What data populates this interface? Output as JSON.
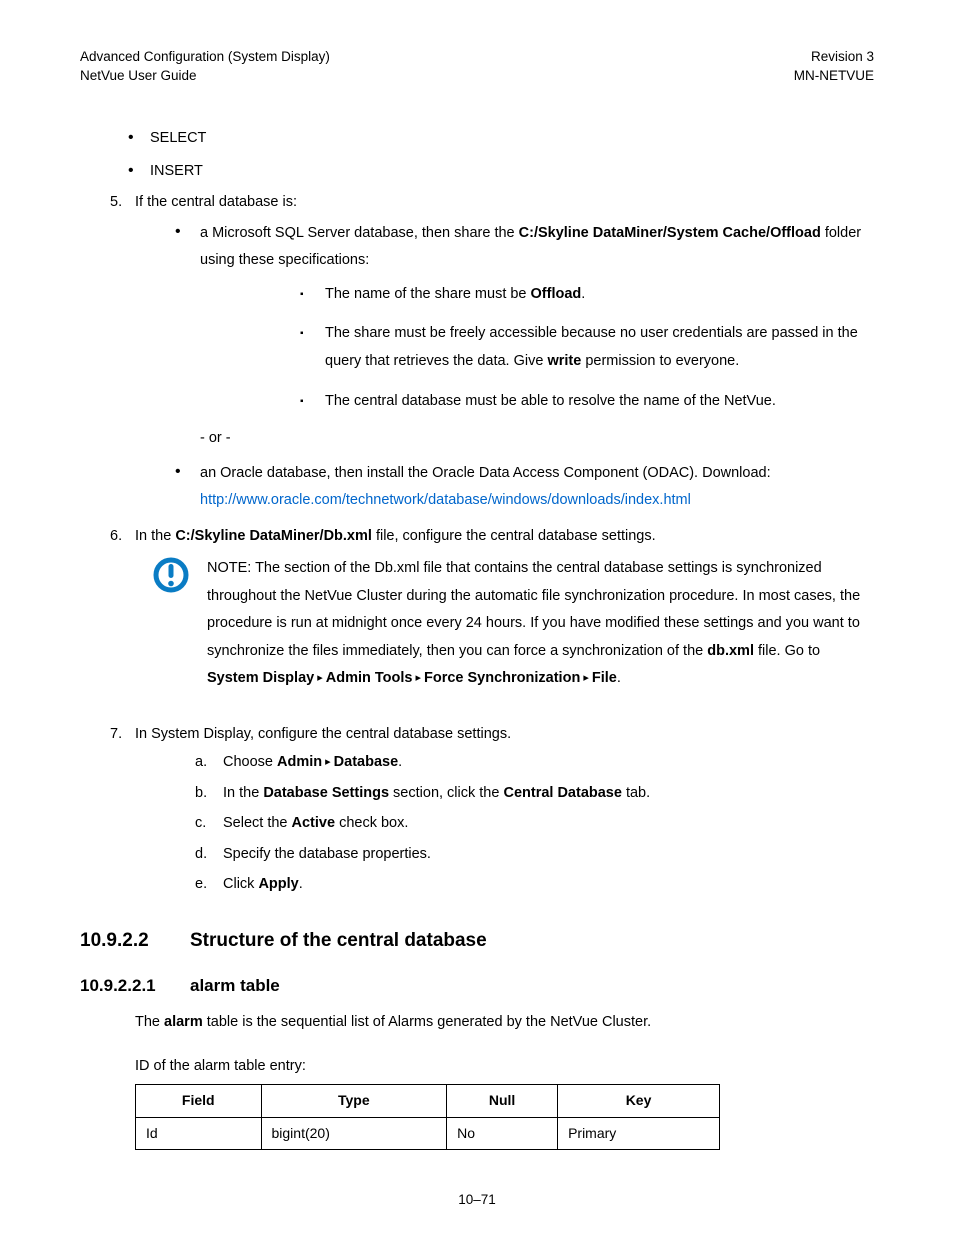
{
  "header": {
    "left_line1": "Advanced Configuration (System Display)",
    "left_line2": "NetVue User Guide",
    "right_line1": "Revision 3",
    "right_line2": "MN-NETVUE"
  },
  "top_bullets": [
    "SELECT",
    "INSERT"
  ],
  "step5": {
    "num": "5.",
    "intro": "If the central database is:",
    "sqlserver_pre": "a Microsoft SQL Server database, then share the ",
    "sqlserver_bold": "C:/Skyline DataMiner/System Cache/Offload",
    "sqlserver_post": " folder using these specifications:",
    "spec1_pre": "The name of the share must be ",
    "spec1_bold": "Offload",
    "spec1_post": ".",
    "spec2_pre": "The share must be freely accessible because no user credentials are passed in the query that retrieves the data. Give ",
    "spec2_bold": "write",
    "spec2_post": " permission to everyone.",
    "spec3": "The central database must be able to resolve the name of the NetVue.",
    "or": "- or -",
    "oracle_text": "an Oracle database, then install the Oracle Data Access Component (ODAC). Download: ",
    "oracle_link": "http://www.oracle.com/technetwork/database/windows/downloads/index.html"
  },
  "step6": {
    "num": "6.",
    "pre": "In the ",
    "bold": "C:/Skyline DataMiner/Db.xml",
    "post": " file, configure the central database settings.",
    "note_pre": "NOTE:  The section of the Db.xml file that contains the central database settings is synchronized throughout the NetVue Cluster during the automatic file synchronization procedure. In most cases, the procedure is run at midnight once every 24 hours. If you have modified these settings and you want to synchronize the files immediately, then you can force a synchronization of the ",
    "note_b1": "db.xml",
    "note_mid1": " file. Go to ",
    "note_b2": "System Display",
    "note_b3": "Admin Tools",
    "note_b4": "Force Synchronization",
    "note_b5": "File",
    "note_end": "."
  },
  "step7": {
    "num": "7.",
    "intro": "In System Display, configure the central database settings.",
    "a_label": "a.",
    "a_pre": "Choose ",
    "a_b1": "Admin",
    "a_b2": "Database",
    "a_post": ".",
    "b_label": "b.",
    "b_pre": "In the ",
    "b_b1": "Database Settings",
    "b_mid": " section, click the ",
    "b_b2": "Central Database",
    "b_post": " tab.",
    "c_label": "c.",
    "c_pre": "Select the ",
    "c_b1": "Active",
    "c_post": " check box.",
    "d_label": "d.",
    "d_text": "Specify the database properties.",
    "e_label": "e.",
    "e_pre": "Click ",
    "e_b1": "Apply",
    "e_post": "."
  },
  "section": {
    "num": "10.9.2.2",
    "title": "Structure of the central database"
  },
  "subsection": {
    "num": "10.9.2.2.1",
    "title": "alarm table"
  },
  "alarm_intro_pre": "The ",
  "alarm_intro_bold": "alarm",
  "alarm_intro_post": " table is the sequential list of Alarms generated by the NetVue Cluster.",
  "alarm_id_caption": "ID of the alarm table entry:",
  "table": {
    "headers": [
      "Field",
      "Type",
      "Null",
      "Key"
    ],
    "row": [
      "Id",
      "bigint(20)",
      "No",
      "Primary"
    ]
  },
  "footer": "10–71"
}
